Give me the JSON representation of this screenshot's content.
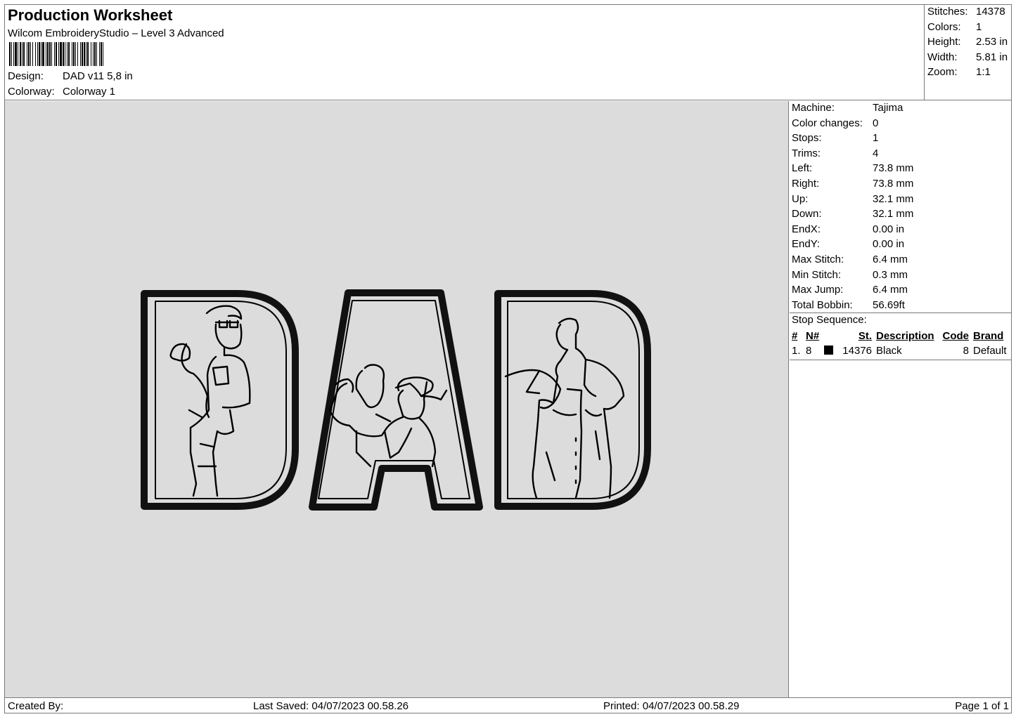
{
  "header": {
    "title": "Production Worksheet",
    "software": "Wilcom EmbroideryStudio – Level 3 Advanced",
    "design_label": "Design:",
    "design_value": "DAD v11 5,8 in",
    "colorway_label": "Colorway:",
    "colorway_value": "Colorway 1"
  },
  "summary": {
    "stitches_label": "Stitches:",
    "stitches": "14378",
    "colors_label": "Colors:",
    "colors": "1",
    "height_label": "Height:",
    "height": "2.53 in",
    "width_label": "Width:",
    "width": "5.81 in",
    "zoom_label": "Zoom:",
    "zoom": "1:1"
  },
  "machine": [
    {
      "label": "Machine:",
      "value": "Tajima"
    },
    {
      "label": "Color changes:",
      "value": "0"
    },
    {
      "label": "Stops:",
      "value": "1"
    },
    {
      "label": "Trims:",
      "value": "4"
    },
    {
      "label": "Left:",
      "value": "73.8 mm"
    },
    {
      "label": "Right:",
      "value": "73.8 mm"
    },
    {
      "label": "Up:",
      "value": "32.1 mm"
    },
    {
      "label": "Down:",
      "value": "32.1 mm"
    },
    {
      "label": "EndX:",
      "value": "0.00 in"
    },
    {
      "label": "EndY:",
      "value": "0.00 in"
    },
    {
      "label": "Max Stitch:",
      "value": "6.4 mm"
    },
    {
      "label": "Min Stitch:",
      "value": "0.3 mm"
    },
    {
      "label": "Max Jump:",
      "value": "6.4 mm"
    },
    {
      "label": "Total Bobbin:",
      "value": "56.69ft"
    }
  ],
  "stop_sequence": {
    "title": "Stop Sequence:",
    "headers": {
      "num": "#",
      "n": "N#",
      "st": "St.",
      "desc": "Description",
      "code": "Code",
      "brand": "Brand"
    },
    "rows": [
      {
        "num": "1.",
        "n": "8",
        "color": "#000000",
        "st": "14376",
        "desc": "Black",
        "code": "8",
        "brand": "Default"
      }
    ]
  },
  "footer": {
    "created": "Created By:",
    "saved": "Last Saved: 04/07/2023 00.58.26",
    "printed": "Printed: 04/07/2023 00.58.29",
    "page": "Page 1 of 1"
  },
  "colors": {
    "thread": "#000000",
    "background": "#dcdcdc",
    "border": "#7a7a7a"
  }
}
